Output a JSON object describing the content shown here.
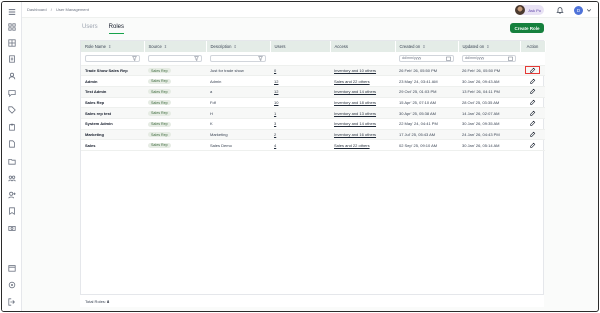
{
  "breadcrumb": [
    "Dashboard",
    "/",
    "User Management"
  ],
  "user": {
    "name": "Ask Po",
    "initial": "D"
  },
  "tabs": [
    {
      "label": "Users",
      "active": false
    },
    {
      "label": "Roles",
      "active": true
    }
  ],
  "create_button": "Create Role",
  "columns": [
    "Role Name",
    "Source",
    "Description",
    "Users",
    "Access",
    "Created on",
    "Updated on",
    "Action"
  ],
  "filters": {
    "created_placeholder": "dd/mm/yyyy",
    "updated_placeholder": "dd/mm/yyyy"
  },
  "rows": [
    {
      "name": "Trade Show Sales Rep",
      "source": "Sales Rep",
      "description": "Just for trade show",
      "users": "0",
      "access": "Inventory and 10 others",
      "created": "26 Feb' 26, 05:50 PM",
      "updated": "26 Feb' 26, 05:50 PM"
    },
    {
      "name": "Admin",
      "source": "Sales Rep",
      "description": "Admin",
      "users": "12",
      "access": "Sales and 22 others",
      "created": "23 May' 24, 03:41 AM",
      "updated": "30 Jan' 26, 09:43 AM"
    },
    {
      "name": "Test Admin",
      "source": "Sales Rep",
      "description": "a",
      "users": "12",
      "access": "Inventory and 14 others",
      "created": "29 Oct' 25, 01:03 PM",
      "updated": "13 Feb' 26, 04:11 PM"
    },
    {
      "name": "Sales Rep",
      "source": "Sales Rep",
      "description": "Fdf",
      "users": "10",
      "access": "Inventory and 18 others",
      "created": "15 Apr' 25, 07:10 AM",
      "updated": "28 Oct' 25, 03:35 AM"
    },
    {
      "name": "Sales rep test",
      "source": "Sales Rep",
      "description": "H",
      "users": "1",
      "access": "Inventory and 13 others",
      "created": "30 Apr' 25, 05:38 AM",
      "updated": "14 Jan' 26, 02:07 AM"
    },
    {
      "name": "System Admin",
      "source": "Sales Rep",
      "description": "K",
      "users": "3",
      "access": "Inventory and 14 others",
      "created": "22 May' 24, 04:41 PM",
      "updated": "30 Jan' 26, 09:35 AM"
    },
    {
      "name": "Marketing",
      "source": "Sales Rep",
      "description": "Marketing",
      "users": "2",
      "access": "Inventory and 16 others",
      "created": "17 Jul' 25, 05:43 AM",
      "updated": "24 Jan' 26, 04:43 PM"
    },
    {
      "name": "Sales",
      "source": "Sales Rep",
      "description": "Sales Demo",
      "users": "4",
      "access": "Sales and 22 others",
      "created": "02 Sep' 25, 09:10 AM",
      "updated": "30 Jan' 26, 05:14 AM"
    }
  ],
  "footer": {
    "label": "Total Roles:",
    "count": "8"
  }
}
